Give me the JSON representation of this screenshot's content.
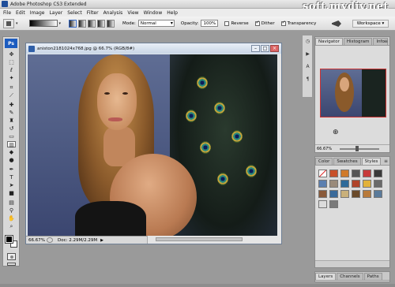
{
  "window": {
    "title": "Adobe Photoshop CS3 Extended",
    "watermark": "soft.mydiv.net"
  },
  "menu": [
    "File",
    "Edit",
    "Image",
    "Layer",
    "Select",
    "Filter",
    "Analysis",
    "View",
    "Window",
    "Help"
  ],
  "options": {
    "mode_label": "Mode:",
    "mode_value": "Normal",
    "opacity_label": "Opacity:",
    "opacity_value": "100%",
    "reverse_label": "Reverse",
    "dither_label": "Dither",
    "transparency_label": "Transparency",
    "workspace_label": "Workspace ▾"
  },
  "document": {
    "title": "aniston2181024x768.jpg @ 66.7% (RGB/8#)",
    "zoom": "66.67%",
    "doc_size": "Doc: 2.29M/2.29M"
  },
  "panels": {
    "navigator": {
      "tabs": [
        "Navigator",
        "Histogram",
        "Info"
      ],
      "zoom": "66.67%"
    },
    "styles": {
      "tabs": [
        "Color",
        "Swatches",
        "Styles"
      ],
      "swatch_colors": [
        "#f4f4f4",
        "#c8502a",
        "#d07a2a",
        "#555555",
        "#c73a3a",
        "#3a3a3a",
        "#5b7fb0",
        "#9a8a7a",
        "#2f6a9a",
        "#b0442a",
        "#e2b23a",
        "#6a6a6a",
        "#8a5a3a",
        "#3a6a9a",
        "#c9b07a",
        "#6a4a2a",
        "#b87a3a",
        "#5a7a9a",
        "#dcdcdc",
        "#7a7a7a"
      ]
    },
    "layers": {
      "tabs": [
        "Layers",
        "Channels",
        "Paths"
      ]
    }
  },
  "colors": {
    "foreground": "#000000",
    "background": "#ffffff",
    "accent": "#1c5cbf"
  }
}
